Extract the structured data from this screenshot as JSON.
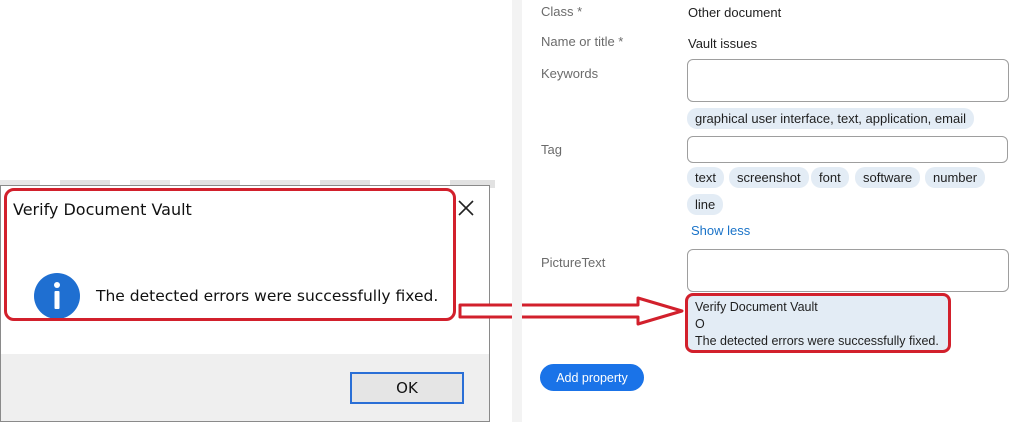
{
  "dialog": {
    "title": "Verify Document Vault",
    "message": "The detected errors were successfully fixed.",
    "ok_label": "OK",
    "icon": "info-icon",
    "close_icon": "close-icon"
  },
  "properties": {
    "class": {
      "label": "Class *",
      "value": "Other document"
    },
    "name": {
      "label": "Name or title *",
      "value": "Vault issues"
    },
    "keywords": {
      "label": "Keywords",
      "value": "",
      "suggestion": "graphical user interface, text, application, email"
    },
    "tag": {
      "label": "Tag",
      "value": "",
      "chips": [
        "text",
        "screenshot",
        "font",
        "software",
        "number",
        "line"
      ],
      "show_less": "Show less"
    },
    "picture_text": {
      "label": "PictureText",
      "value": "",
      "lines": [
        "Verify Document Vault",
        "O",
        "The detected errors were successfully fixed."
      ]
    },
    "add_property_label": "Add property"
  },
  "colors": {
    "highlight": "#d2202c",
    "accent": "#1a73e8",
    "chip": "#e3ecf5",
    "info_icon": "#1f6fd1"
  }
}
